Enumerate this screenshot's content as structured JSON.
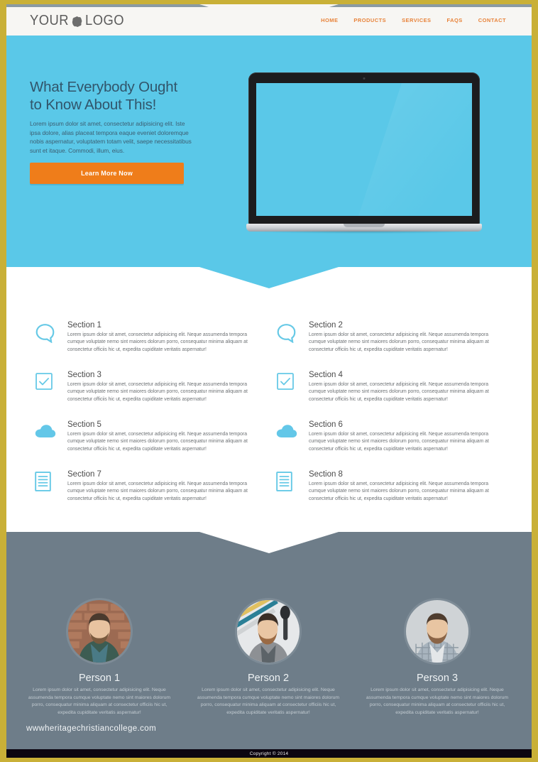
{
  "brand": {
    "logo_word_1": "YOUR",
    "logo_word_2": "LOGO",
    "accent_blue": "#5ac8e8",
    "accent_orange": "#ef7d1a",
    "nav_link_color": "#e8833a",
    "team_bg": "#6e7d89",
    "page_border": "#c9b037"
  },
  "nav": {
    "items": [
      {
        "label": "HOME"
      },
      {
        "label": "PRODUCTS"
      },
      {
        "label": "SERVICES"
      },
      {
        "label": "FAQS"
      },
      {
        "label": "CONTACT"
      }
    ]
  },
  "hero": {
    "title_line_1": "What Everybody Ought",
    "title_line_2": "to Know About This!",
    "paragraph": "Lorem ipsum dolor sit amet, consectetur adipisicing elit. Iste ipsa dolore, alias placeat tempora eaque eveniet doloremque nobis aspernatur, voluptatem totam velit, saepe necessitatibus sunt et itaque. Commodi, illum, eius.",
    "cta_label": "Learn More Now",
    "device": "macbook-pro-mockup"
  },
  "features": {
    "body": "Lorem ipsum dolor sit amet, consectetur adipisicing elit. Neque assumenda tempora cumque voluptate nemo sint maiores dolorum porro, consequatur minima aliquam at consectetur officiis hic ut, expedita cupiditate veritatis aspernatur!",
    "items": [
      {
        "title": "Section 1",
        "icon": "speech-bubble-icon"
      },
      {
        "title": "Section 2",
        "icon": "speech-bubble-icon"
      },
      {
        "title": "Section 3",
        "icon": "checkbox-check-icon"
      },
      {
        "title": "Section 4",
        "icon": "checkbox-check-icon"
      },
      {
        "title": "Section 5",
        "icon": "cloud-icon"
      },
      {
        "title": "Section 6",
        "icon": "cloud-icon"
      },
      {
        "title": "Section 7",
        "icon": "document-lines-icon"
      },
      {
        "title": "Section 8",
        "icon": "document-lines-icon"
      }
    ]
  },
  "team": {
    "bio": "Lorem ipsum dolor sit amet, consectetur adipisicing elit. Neque assumenda tempora cumque voluptate nemo sint maiores dolorum porro, consequatur minima aliquam at consectetur officiis hic ut, expedita cupiditate veritatis aspernatur!",
    "members": [
      {
        "name": "Person 1"
      },
      {
        "name": "Person 2"
      },
      {
        "name": "Person 3"
      }
    ]
  },
  "watermark": {
    "text": "wwwheritagechristiancollege.com"
  },
  "footer": {
    "copyright": "Copyright © 2014"
  }
}
